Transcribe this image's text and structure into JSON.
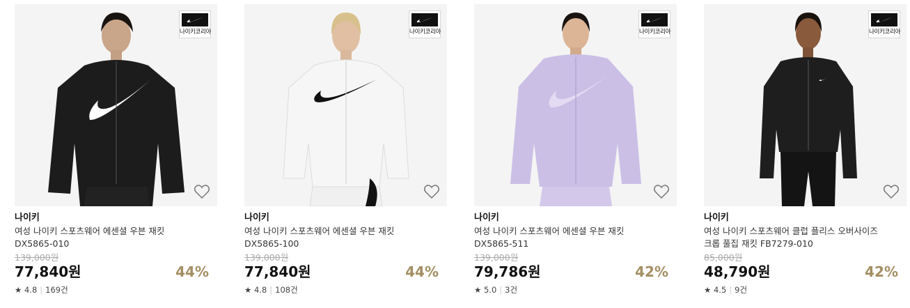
{
  "badge_label": "나이키코리아",
  "products": [
    {
      "brand": "나이키",
      "name": "여성 나이키 스포츠웨어 에센셜 우븐 재킷\nDX5865-010",
      "original_price": "139,000원",
      "price": "77,840원",
      "discount": "44%",
      "star": "★",
      "rating": "4.8",
      "reviews": "169건",
      "jacket_color": "#1c1c1c",
      "swoosh_color": "#ffffff",
      "pants_color": "#222222"
    },
    {
      "brand": "나이키",
      "name": "여성 나이키 스포츠웨어 에센셜 우븐 재킷\nDX5865-100",
      "original_price": "139,000원",
      "price": "77,840원",
      "discount": "44%",
      "star": "★",
      "rating": "4.8",
      "reviews": "108건",
      "jacket_color": "#f6f6f6",
      "swoosh_color": "#111111",
      "pants_color": "#f0f0f0"
    },
    {
      "brand": "나이키",
      "name": "여성 나이키 스포츠웨어 에센셜 우븐 재킷\nDX5865-511",
      "original_price": "139,000원",
      "price": "79,786원",
      "discount": "42%",
      "star": "★",
      "rating": "5.0",
      "reviews": "3건",
      "jacket_color": "#cbbfe6",
      "swoosh_color": "#e2dbf2",
      "pants_color": "#d3c8ea"
    },
    {
      "brand": "나이키",
      "name": "여성 나이키 스포츠웨어 클럽 플리스 오버사이즈\n크롭 풀집 재킷 FB7279-010",
      "original_price": "85,000원",
      "price": "48,790원",
      "discount": "42%",
      "star": "★",
      "rating": "4.5",
      "reviews": "9건",
      "jacket_color": "#1e1e1e",
      "swoosh_color": "#ffffff",
      "pants_color": "#141414"
    }
  ]
}
